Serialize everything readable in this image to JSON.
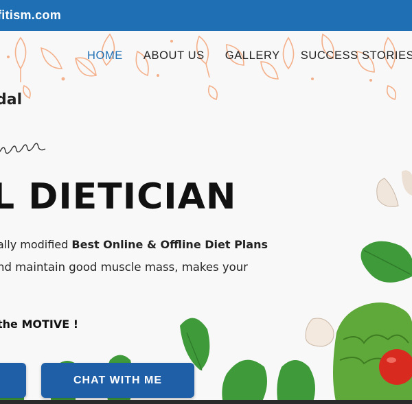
{
  "topbar": {
    "brand": "fitism.com"
  },
  "nav": {
    "items": [
      {
        "label": "HOME",
        "active": true
      },
      {
        "label": "ABOUT US",
        "active": false
      },
      {
        "label": "GALLERY",
        "active": false
      },
      {
        "label": "SUCCESS STORIES",
        "active": false
      }
    ]
  },
  "hero": {
    "name": "dal",
    "headline": "L DIETICIAN",
    "desc_line1_prefix": "ally modified ",
    "desc_line1_bold": "Best Online & Offline Diet Plans",
    "desc_line2": "nd maintain good muscle mass, makes your",
    "motive": "the MOTIVE !"
  },
  "buttons": {
    "chat_label": "CHAT WITH ME"
  },
  "colors": {
    "brand_blue": "#1f6fb5",
    "button_blue": "#1f5fa8",
    "leaf_orange": "#f4b08a",
    "spinach_green": "#3f9a3a",
    "tomato_red": "#d92a1f"
  }
}
